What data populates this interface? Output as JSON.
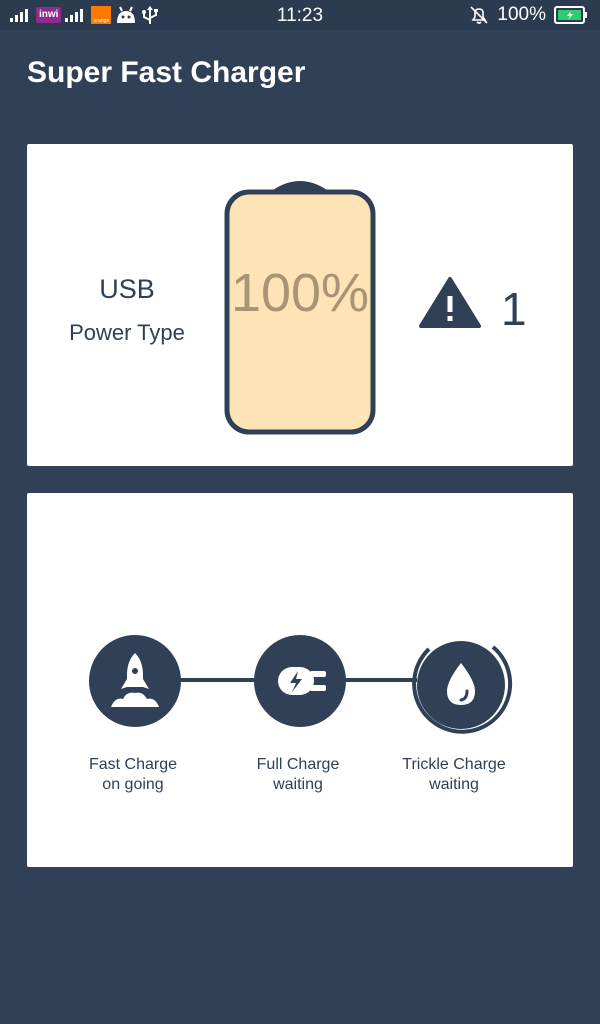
{
  "status_bar": {
    "carrier": "inwi",
    "carrier2": "orange",
    "time": "11:23",
    "battery_percent": "100%"
  },
  "app": {
    "title": "Super Fast Charger"
  },
  "power": {
    "type_value": "USB",
    "type_label": "Power Type"
  },
  "battery": {
    "level_text": "100%",
    "level": 1.0,
    "fill_color": "#fde3b6",
    "outline_color": "#2f4057"
  },
  "warnings": {
    "count": "1",
    "icon": "warning-icon"
  },
  "stages": [
    {
      "icon": "rocket-icon",
      "title": "Fast Charge",
      "status": "on going"
    },
    {
      "icon": "plug-icon",
      "title": "Full Charge",
      "status": "waiting"
    },
    {
      "icon": "drop-icon",
      "title": "Trickle Charge",
      "status": "waiting"
    }
  ],
  "colors": {
    "background": "#2f4057",
    "card": "#ffffff",
    "accent": "#2f4057"
  }
}
